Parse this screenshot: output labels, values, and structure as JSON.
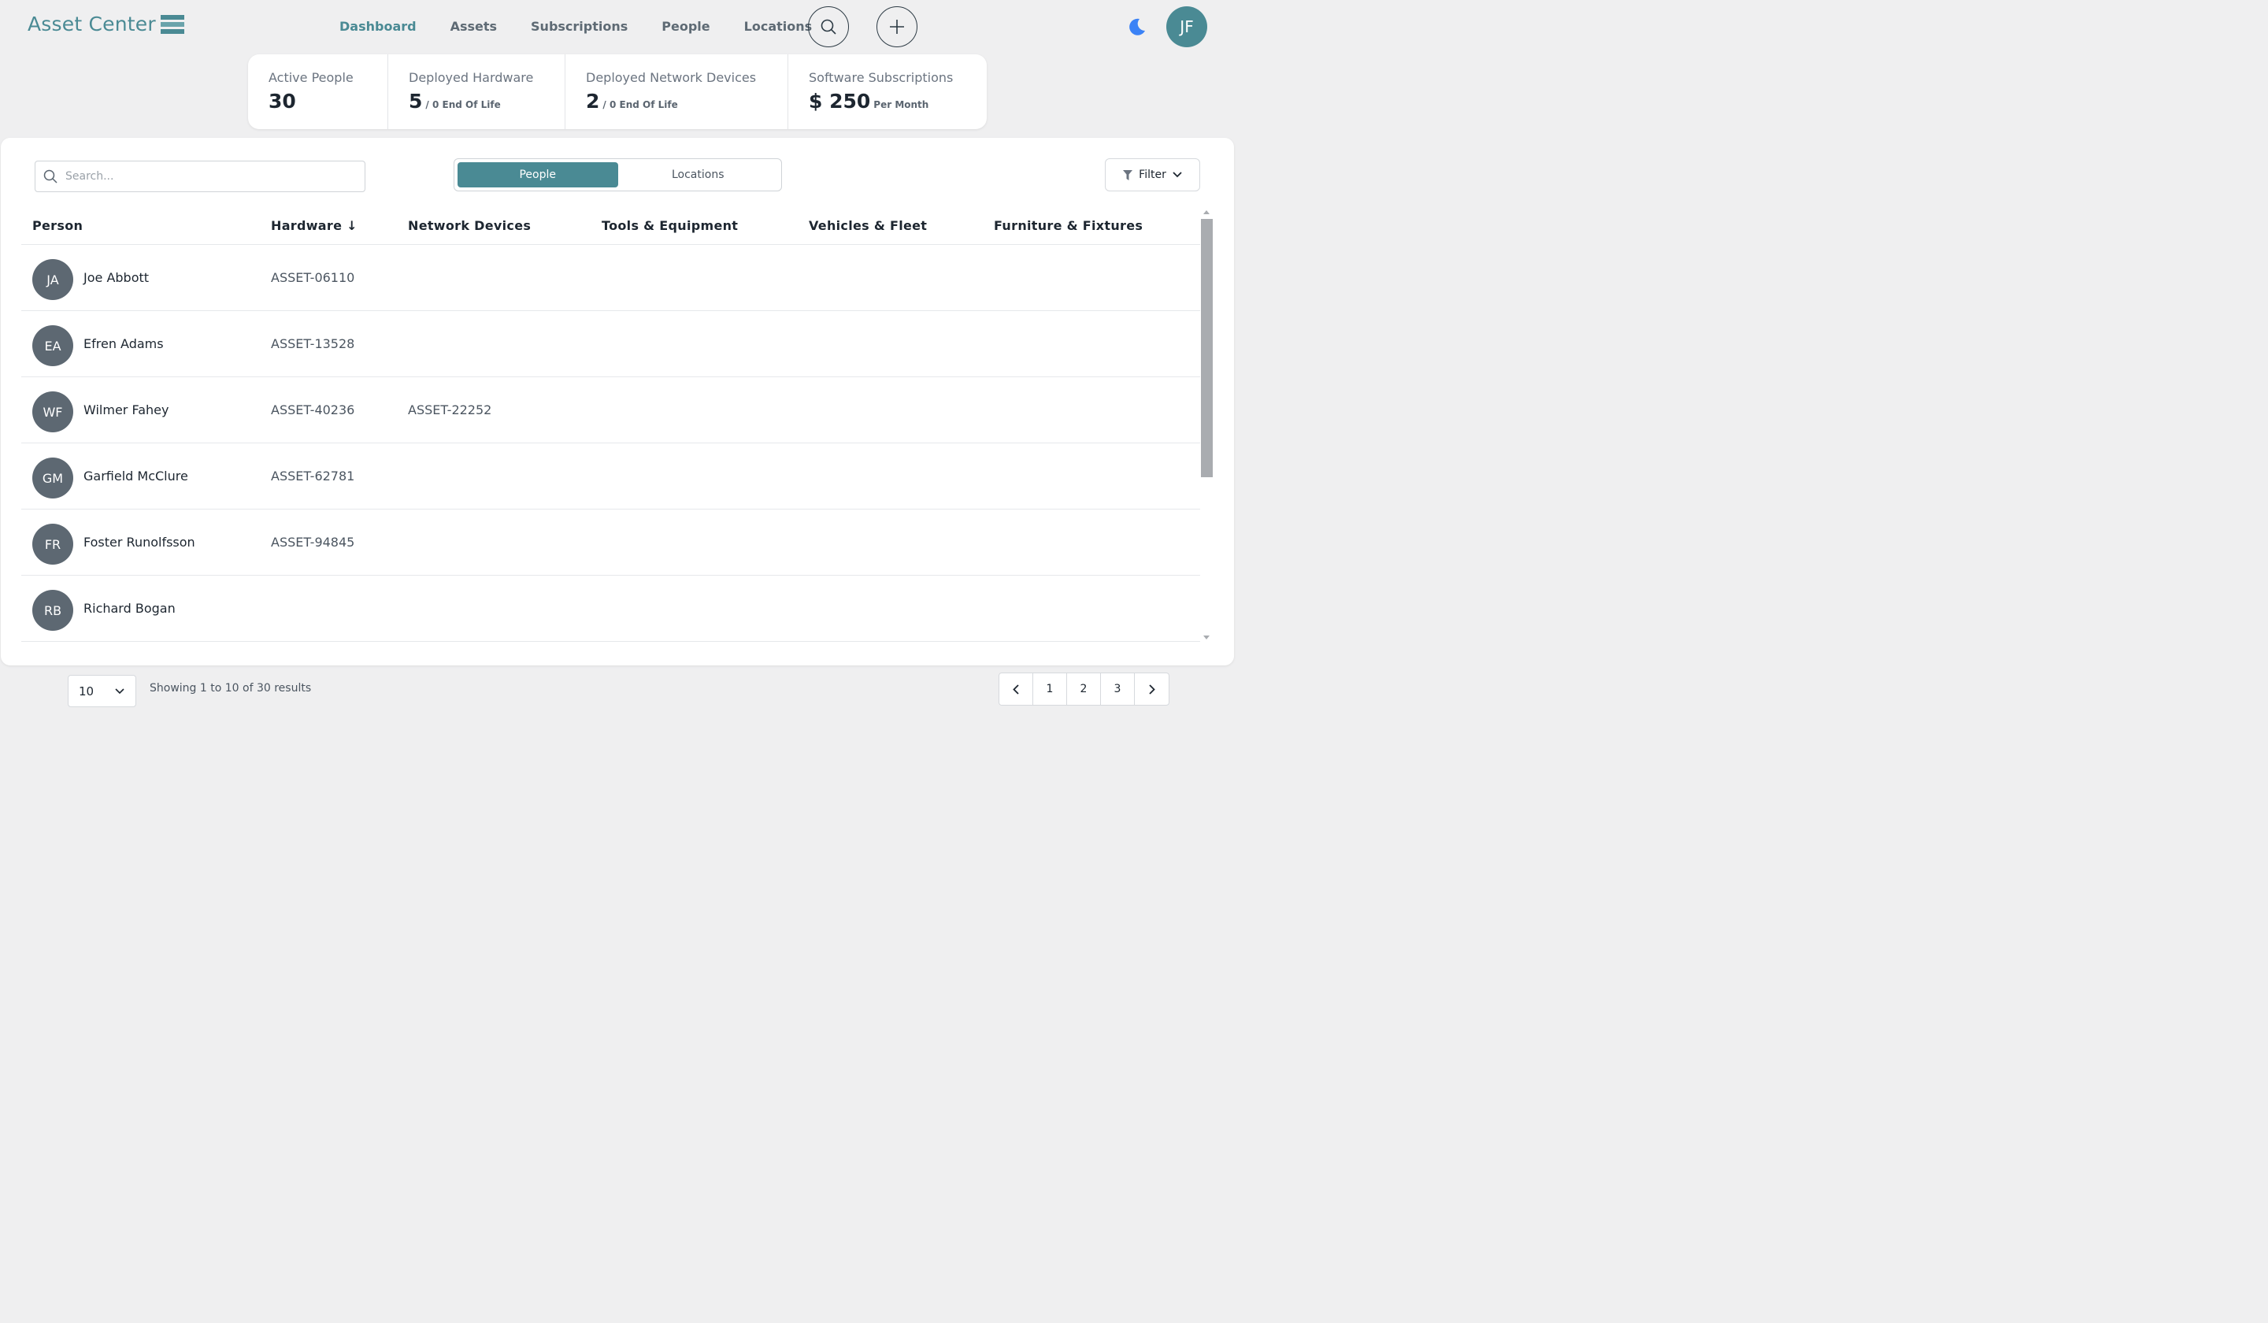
{
  "header": {
    "logo_text": "Asset Center",
    "nav": [
      {
        "label": "Dashboard",
        "active": true
      },
      {
        "label": "Assets",
        "active": false
      },
      {
        "label": "Subscriptions",
        "active": false
      },
      {
        "label": "People",
        "active": false
      },
      {
        "label": "Locations",
        "active": false
      }
    ],
    "user_initials": "JF",
    "accent_color": "#4a8a94"
  },
  "stats": [
    {
      "label": "Active People",
      "value": "30",
      "sub": ""
    },
    {
      "label": "Deployed Hardware",
      "value": "5",
      "sub": "/ 0 End Of Life"
    },
    {
      "label": "Deployed Network Devices",
      "value": "2",
      "sub": "/ 0 End Of Life"
    },
    {
      "label": "Software Subscriptions",
      "value": "$ 250",
      "sub": "Per Month"
    }
  ],
  "toolbar": {
    "search_placeholder": "Search...",
    "toggle": [
      "People",
      "Locations"
    ],
    "filter_label": "Filter"
  },
  "table": {
    "columns": [
      "Person",
      "Hardware ↓",
      "Network Devices",
      "Tools & Equipment",
      "Vehicles & Fleet",
      "Furniture & Fixtures"
    ],
    "rows": [
      {
        "initials": "JA",
        "name": "Joe Abbott",
        "hardware": "ASSET-06110",
        "network": ""
      },
      {
        "initials": "EA",
        "name": "Efren Adams",
        "hardware": "ASSET-13528",
        "network": ""
      },
      {
        "initials": "WF",
        "name": "Wilmer Fahey",
        "hardware": "ASSET-40236",
        "network": "ASSET-22252"
      },
      {
        "initials": "GM",
        "name": "Garfield McClure",
        "hardware": "ASSET-62781",
        "network": ""
      },
      {
        "initials": "FR",
        "name": "Foster Runolfsson",
        "hardware": "ASSET-94845",
        "network": ""
      },
      {
        "initials": "RB",
        "name": "Richard Bogan",
        "hardware": "",
        "network": ""
      }
    ]
  },
  "footer": {
    "page_size": "10",
    "showing_text": "Showing 1 to 10 of 30 results",
    "pages": [
      "1",
      "2",
      "3"
    ]
  }
}
